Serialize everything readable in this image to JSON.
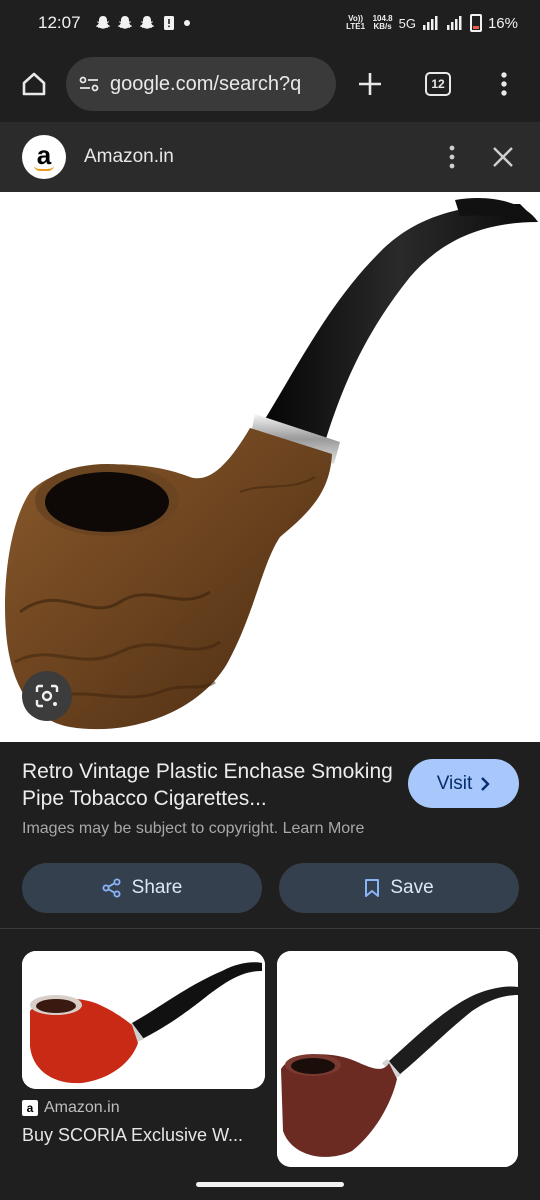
{
  "status": {
    "time": "12:07",
    "net_top": "Vo)) LTE1",
    "speed_value": "104.8",
    "speed_unit": "KB/s",
    "network": "5G",
    "battery": "16%"
  },
  "browser": {
    "url": "google.com/search?q",
    "tab_count": "12"
  },
  "source": {
    "name": "Amazon.in"
  },
  "result": {
    "title": "Retro Vintage Plastic Enchase Smoking Pipe Tobacco Cigarettes...",
    "visit_label": "Visit",
    "copyright": "Images may be subject to copyright. Learn More",
    "share_label": "Share",
    "save_label": "Save"
  },
  "related": [
    {
      "source": "Amazon.in",
      "title": "Buy SCORIA Exclusive W..."
    },
    {
      "source": "",
      "title": ""
    }
  ],
  "colors": {
    "background": "#1f1f1f",
    "visit_button": "#a8c7fa",
    "action_button": "#35404f"
  }
}
